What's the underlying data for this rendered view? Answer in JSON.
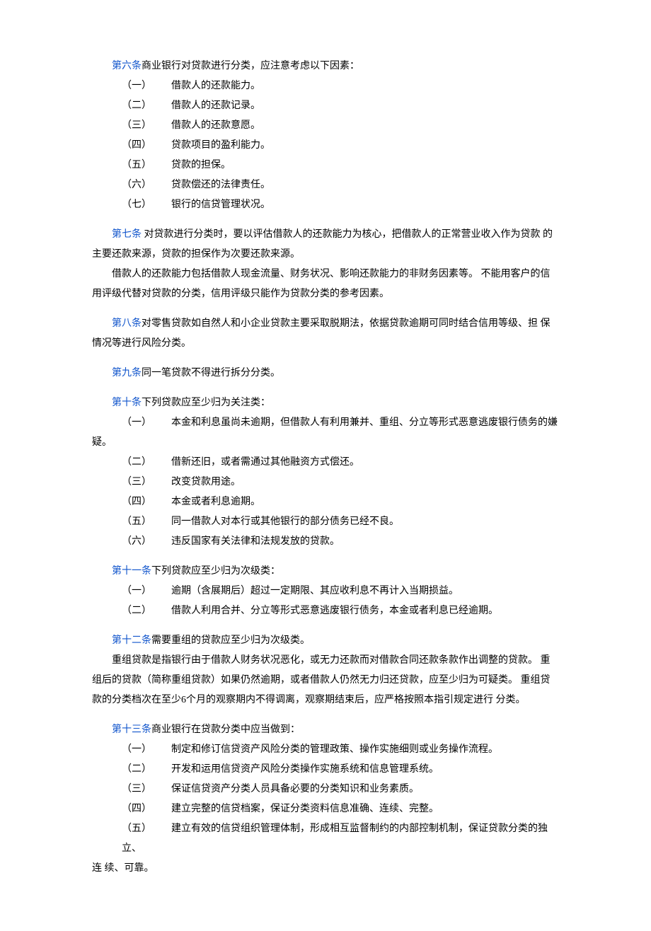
{
  "articles": {
    "a6": {
      "label": "第六条",
      "intro": "商业银行对贷款进行分类，应注意考虑以下因素：",
      "items": [
        {
          "num": "（一）",
          "text": "借款人的还款能力。"
        },
        {
          "num": "（二）",
          "text": "借款人的还款记录。"
        },
        {
          "num": "（三）",
          "text": "借款人的还款意愿。"
        },
        {
          "num": "（四）",
          "text": "贷款项目的盈利能力。"
        },
        {
          "num": "（五）",
          "text": "贷款的担保。"
        },
        {
          "num": "（六）",
          "text": "贷款偿还的法律责任。"
        },
        {
          "num": "（七）",
          "text": "银行的信贷管理状况。"
        }
      ]
    },
    "a7": {
      "label": "第七条",
      "p1": " 对贷款进行分类时，要以评估借款人的还款能力为核心，把借款人的正常营业收入作为贷款 的主要还款来源，贷款的担保作为次要还款来源。",
      "p2": "借款人的还款能力包括借款人现金流量、财务状况、影响还款能力的非财务因素等。 不能用客户的信用评级代替对贷款的分类，信用评级只能作为贷款分类的参考因素。"
    },
    "a8": {
      "label": "第八条",
      "text": "对零售贷款如自然人和小企业贷款主要采取脱期法，依据贷款逾期可同时结合信用等级、担 保情况等进行风险分类。"
    },
    "a9": {
      "label": "第九条",
      "text": "同一笔贷款不得进行拆分分类。"
    },
    "a10": {
      "label": "第十条",
      "intro": "下列贷款应至少归为关注类：",
      "items": [
        {
          "num": "（一）",
          "text": "本金和利息虽尚未逾期，但借款人有利用兼并、重组、分立等形式恶意逃废银行债务的嫌"
        },
        {
          "num": "（二）",
          "text": "借新还旧，或者需通过其他融资方式偿还。"
        },
        {
          "num": "（三）",
          "text": "改变贷款用途。"
        },
        {
          "num": "（四）",
          "text": "本金或者利息逾期。"
        },
        {
          "num": "（五）",
          "text": "同一借款人对本行或其他银行的部分债务已经不良。"
        },
        {
          "num": "（六）",
          "text": "违反国家有关法律和法规发放的贷款。"
        }
      ],
      "trail1": "疑。"
    },
    "a11": {
      "label": "第十一条",
      "intro": "下列贷款应至少归为次级类：",
      "items": [
        {
          "num": "（一）",
          "text": "逾期（含展期后）超过一定期限、其应收利息不再计入当期损益。"
        },
        {
          "num": "（二）",
          "text": "借款人利用合并、分立等形式恶意逃废银行债务，本金或者利息已经逾期。"
        }
      ]
    },
    "a12": {
      "label": "第十二条",
      "p1": "需要重组的贷款应至少归为次级类。",
      "p2": "重组贷款是指银行由于借款人财务状况恶化，或无力还款而对借款合同还款条款作出调整的贷款。 重组后的贷款（简称重组贷款）如果仍然逾期，或者借款人仍然无力归还贷款，应至少归为可疑类。 重组贷款的分类档次在至少6个月的观察期内不得调离，观察期结束后，应严格按照本指引规定进行 分类。"
    },
    "a13": {
      "label": "第十三条",
      "intro": "商业银行在贷款分类中应当做到：",
      "items": [
        {
          "num": "（一）",
          "text": "制定和修订信贷资产风险分类的管理政策、操作实施细则或业务操作流程。"
        },
        {
          "num": "（二）",
          "text": "开发和运用信贷资产风险分类操作实施系统和信息管理系统。"
        },
        {
          "num": "（三）",
          "text": "保证信贷资产分类人员具备必要的分类知识和业务素质。"
        },
        {
          "num": "（四）",
          "text": "建立完整的信贷档案，保证分类资料信息准确、连续、完整。"
        },
        {
          "num": "（五）",
          "text": "建立有效的信贷组织管理体制，形成相互监督制约的内部控制机制，保证贷款分类的独立、"
        }
      ],
      "trail": "连 续、可靠。"
    }
  }
}
